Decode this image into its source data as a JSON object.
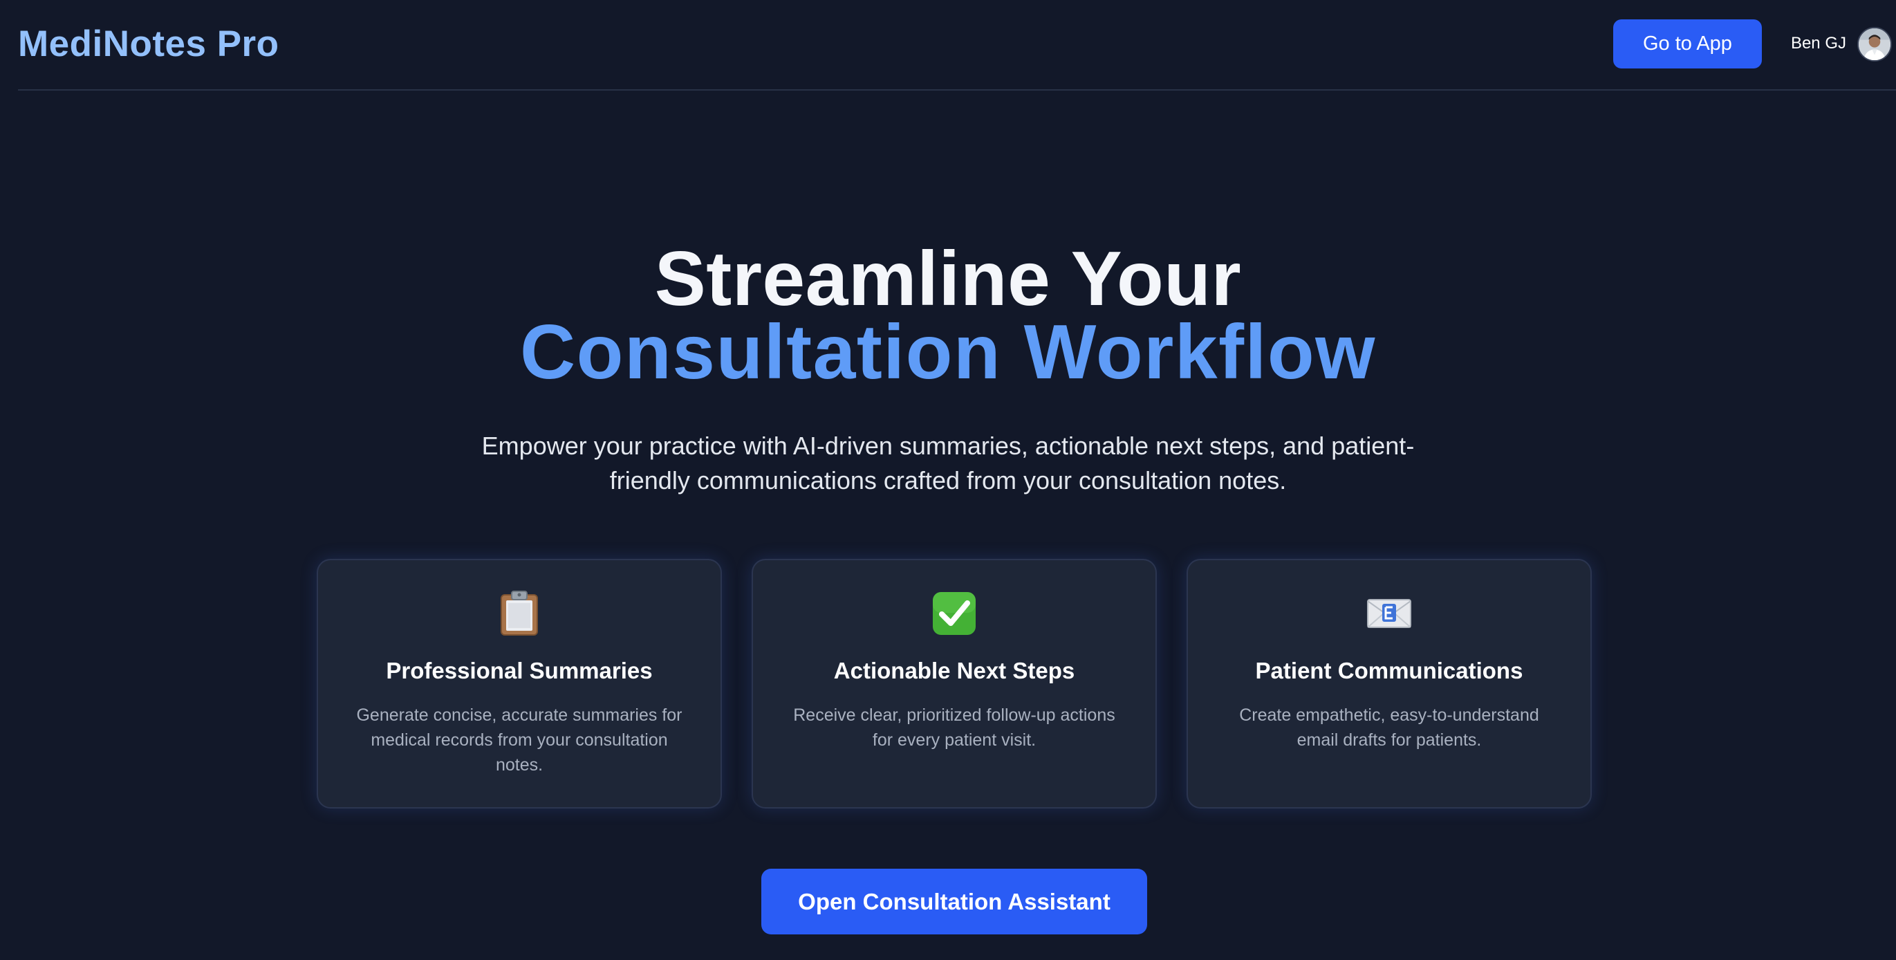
{
  "header": {
    "brand": "MediNotes Pro",
    "go_to_app_label": "Go to App",
    "user_name": "Ben GJ",
    "avatar_icon": "user-avatar"
  },
  "hero": {
    "title_line1": "Streamline Your",
    "title_line2": "Consultation Workflow",
    "subtitle_line1": "Empower your practice with AI-driven summaries, actionable next steps, and patient-",
    "subtitle_line2": "friendly communications crafted from your consultation notes."
  },
  "features": [
    {
      "icon": "clipboard-icon",
      "title": "Professional Summaries",
      "description": "Generate concise, accurate summaries for medical records from your consultation notes."
    },
    {
      "icon": "check-mark-icon",
      "title": "Actionable Next Steps",
      "description": "Receive clear, prioritized follow-up actions for every patient visit."
    },
    {
      "icon": "email-icon",
      "title": "Patient Communications",
      "description": "Create empathetic, easy-to-understand email drafts for patients."
    }
  ],
  "cta": {
    "label": "Open Consultation Assistant"
  },
  "colors": {
    "background": "#121829",
    "brand": "#93c0fb",
    "accent_text": "#5f9cf7",
    "button": "#2a5cf5",
    "card": "#1e2637"
  }
}
